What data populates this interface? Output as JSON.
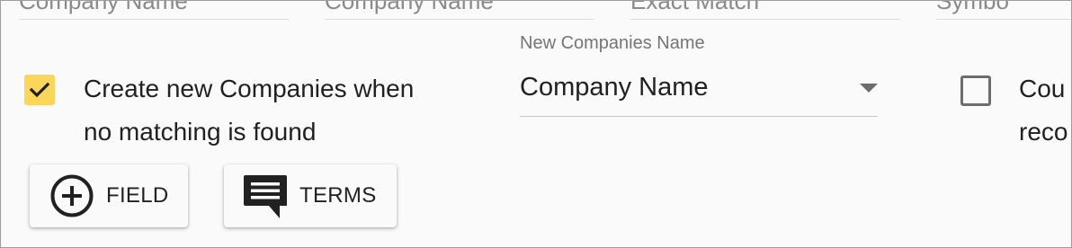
{
  "top_row": [
    {
      "text": "Company Name"
    },
    {
      "text": "Company Name"
    },
    {
      "text": "Exact Match"
    },
    {
      "text": "Symbo"
    }
  ],
  "create_companies": {
    "checked": true,
    "label_line1": "Create new Companies when",
    "label_line2": "no matching is found"
  },
  "new_companies_name": {
    "floating_label": "New Companies Name",
    "value": "Company Name"
  },
  "count_option": {
    "checked": false,
    "label_line1": "Cou",
    "label_line2": "reco"
  },
  "buttons": {
    "field_label": "FIELD",
    "terms_label": "TERMS"
  },
  "colors": {
    "checkbox_checked": "#fbd65a",
    "text": "#212121",
    "muted": "#757575"
  },
  "icons": {
    "checkbox_icon": "checkmark-icon",
    "dropdown_icon": "chevron-down-icon",
    "field_button_icon": "add-circle-icon",
    "terms_button_icon": "comment-icon"
  }
}
